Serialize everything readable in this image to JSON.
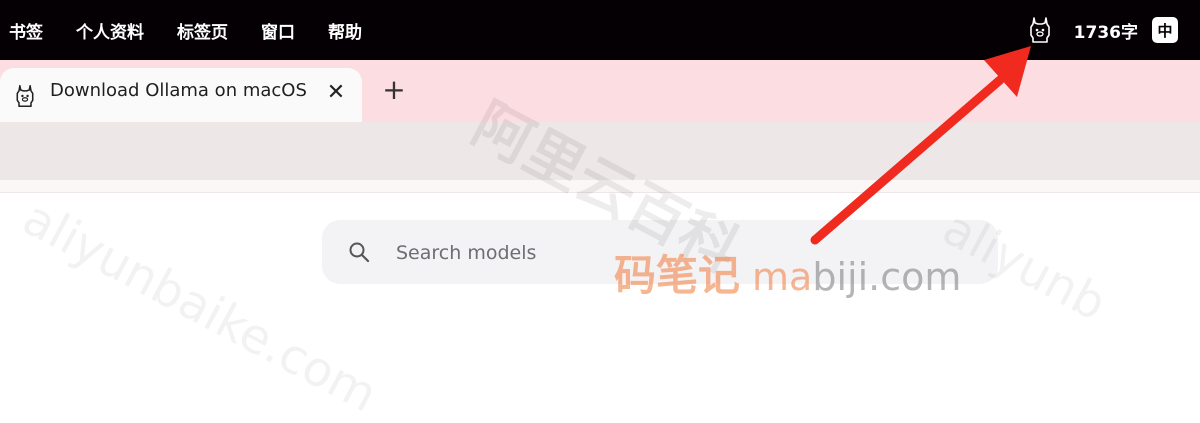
{
  "menubar": {
    "items": [
      "书签",
      "个人资料",
      "标签页",
      "窗口",
      "帮助"
    ],
    "status_icon": "ollama-llama-icon",
    "word_count": "1736字",
    "input_method": "中"
  },
  "tabs": [
    {
      "title": "Download Ollama on macOS",
      "icon": "ollama-llama-icon",
      "close": "✕"
    }
  ],
  "new_tab_label": "+",
  "search": {
    "placeholder": "Search models",
    "value": ""
  },
  "watermarks": {
    "aliyun_cn": "阿里云百科",
    "aliyun_en": "aliyunbaike.com",
    "aliyun_en_right": "aliyunb",
    "mabiji_cn": "码笔记",
    "mabiji_en_accent": "ma",
    "mabiji_en_rest": "biji.com"
  },
  "colors": {
    "menubar_bg": "#050003",
    "tabstrip_bg": "#fcdde2",
    "annotation_arrow": "#f02a1e",
    "watermark_orange": "#f27b3a"
  }
}
